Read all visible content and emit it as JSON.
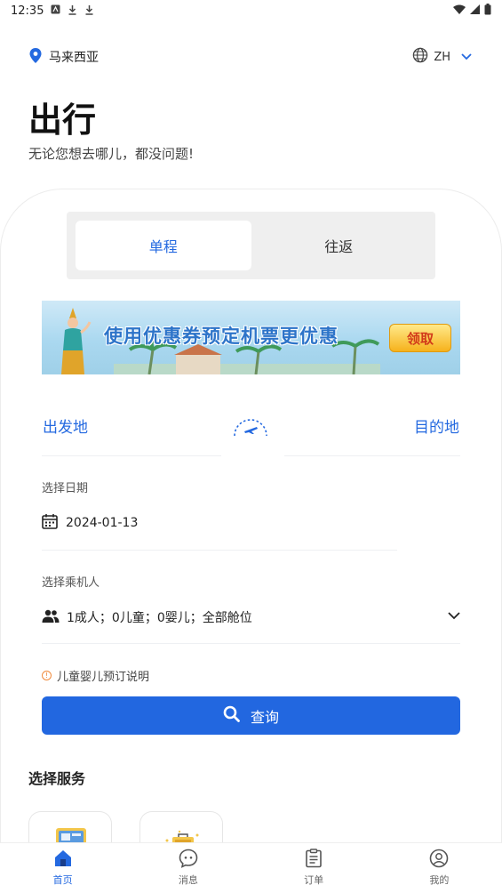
{
  "status_bar": {
    "time": "12:35"
  },
  "header": {
    "location": "马来西亚",
    "language": "ZH"
  },
  "hero": {
    "title": "出行",
    "subtitle": "无论您想去哪儿，都没问题!"
  },
  "trip_type": {
    "tabs": [
      "单程",
      "往返"
    ],
    "selected": "单程"
  },
  "banner": {
    "text": "使用优惠券预定机票更优惠",
    "button": "领取"
  },
  "route": {
    "from": "出发地",
    "to": "目的地"
  },
  "date": {
    "label": "选择日期",
    "value": "2024-01-13"
  },
  "passengers": {
    "label": "选择乘机人",
    "value": "1成人；0儿童；0婴儿；全部舱位"
  },
  "note": "儿童婴儿预订说明",
  "search_button": "查询",
  "services": {
    "title": "选择服务"
  },
  "bottom_nav": [
    {
      "label": "首页",
      "icon": "home-icon",
      "active": true
    },
    {
      "label": "消息",
      "icon": "chat-icon",
      "active": false
    },
    {
      "label": "订单",
      "icon": "order-icon",
      "active": false
    },
    {
      "label": "我的",
      "icon": "profile-icon",
      "active": false
    }
  ],
  "colors": {
    "accent": "#2267e0",
    "tab_bg": "#efefef",
    "warning": "#f08a3c"
  }
}
